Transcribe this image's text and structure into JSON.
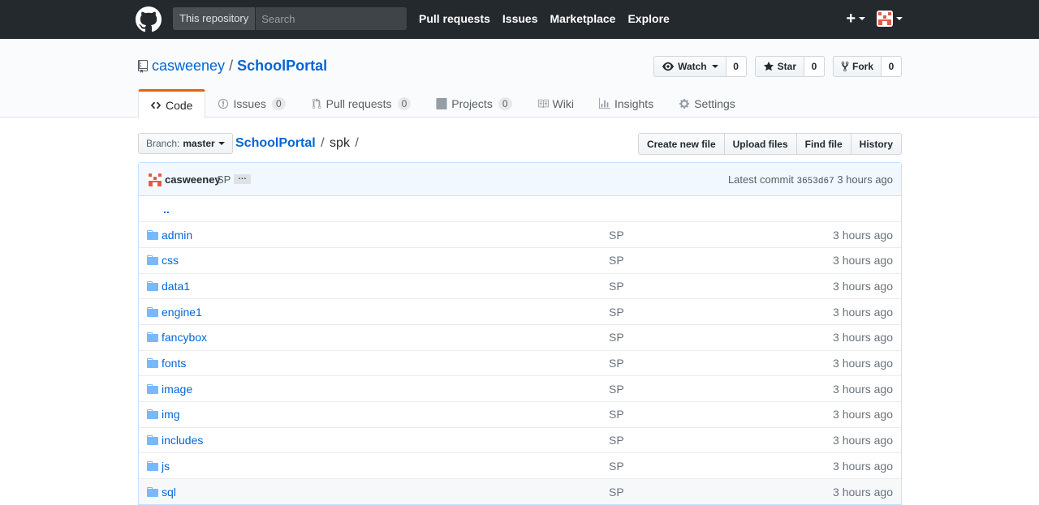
{
  "header": {
    "search_scope": "This repository",
    "search_placeholder": "Search",
    "nav": [
      "Pull requests",
      "Issues",
      "Marketplace",
      "Explore"
    ],
    "plus": "+"
  },
  "repo": {
    "owner": "casweeney",
    "separator": "/",
    "name": "SchoolPortal",
    "watch_label": "Watch",
    "watch_count": "0",
    "star_label": "Star",
    "star_count": "0",
    "fork_label": "Fork",
    "fork_count": "0"
  },
  "tabs": [
    {
      "label": "Code",
      "counter": ""
    },
    {
      "label": "Issues",
      "counter": "0"
    },
    {
      "label": "Pull requests",
      "counter": "0"
    },
    {
      "label": "Projects",
      "counter": "0"
    },
    {
      "label": "Wiki",
      "counter": ""
    },
    {
      "label": "Insights",
      "counter": ""
    },
    {
      "label": "Settings",
      "counter": ""
    }
  ],
  "file_nav": {
    "branch_prefix": "Branch:",
    "branch": "master",
    "crumb_root": "SchoolPortal",
    "crumb_sep": "/",
    "crumb_dir": "spk",
    "crumb_trailing": "/",
    "actions": [
      "Create new file",
      "Upload files",
      "Find file",
      "History"
    ]
  },
  "commit": {
    "author": "casweeney",
    "message": "SP",
    "expander": "…",
    "latest_label": "Latest commit",
    "sha": "3653d67",
    "age": "3 hours ago"
  },
  "up_dir": "..",
  "files": [
    {
      "name": "admin",
      "message": "SP",
      "age": "3 hours ago"
    },
    {
      "name": "css",
      "message": "SP",
      "age": "3 hours ago"
    },
    {
      "name": "data1",
      "message": "SP",
      "age": "3 hours ago"
    },
    {
      "name": "engine1",
      "message": "SP",
      "age": "3 hours ago"
    },
    {
      "name": "fancybox",
      "message": "SP",
      "age": "3 hours ago"
    },
    {
      "name": "fonts",
      "message": "SP",
      "age": "3 hours ago"
    },
    {
      "name": "image",
      "message": "SP",
      "age": "3 hours ago"
    },
    {
      "name": "img",
      "message": "SP",
      "age": "3 hours ago"
    },
    {
      "name": "includes",
      "message": "SP",
      "age": "3 hours ago"
    },
    {
      "name": "js",
      "message": "SP",
      "age": "3 hours ago"
    },
    {
      "name": "sql",
      "message": "SP",
      "age": "3 hours ago"
    }
  ],
  "colors": {
    "header_bg": "#24292e",
    "link": "#0366d6",
    "folder": "#79b8ff",
    "tab_accent": "#e36209",
    "avatar": "#e25c4b"
  }
}
